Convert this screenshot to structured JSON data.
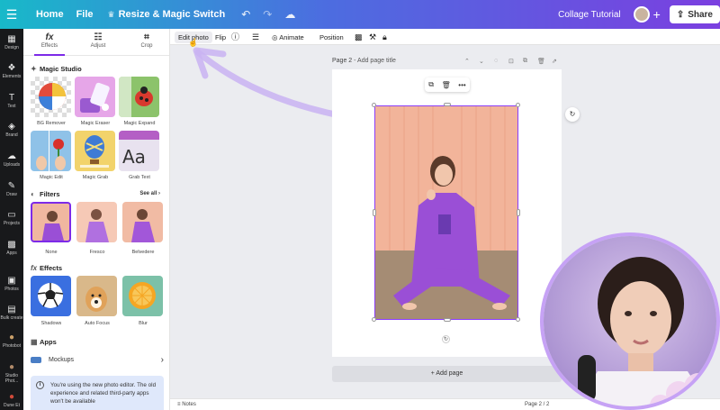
{
  "topbar": {
    "home": "Home",
    "file": "File",
    "resize": "Resize & Magic Switch",
    "title": "Collage Tutorial",
    "share": "Share"
  },
  "rail": [
    {
      "label": "Design",
      "icon": "▦"
    },
    {
      "label": "Elements",
      "icon": "❖"
    },
    {
      "label": "Text",
      "icon": "T"
    },
    {
      "label": "Brand",
      "icon": "◈"
    },
    {
      "label": "Uploads",
      "icon": "☁"
    },
    {
      "label": "Draw",
      "icon": "✎"
    },
    {
      "label": "Projects",
      "icon": "▭"
    },
    {
      "label": "Apps",
      "icon": "▩"
    },
    {
      "label": "Photos",
      "icon": "▣"
    },
    {
      "label": "Bulk create",
      "icon": "▤"
    },
    {
      "label": "Photobot",
      "icon": "●"
    },
    {
      "label": "Studio Phot...",
      "icon": "●"
    },
    {
      "label": "Dune Et",
      "icon": "●"
    }
  ],
  "panel": {
    "tabs": [
      {
        "label": "Effects",
        "icon": "fx"
      },
      {
        "label": "Adjust",
        "icon": "☷"
      },
      {
        "label": "Crop",
        "icon": "⌗"
      }
    ],
    "magic_studio": {
      "title": "Magic Studio",
      "items": [
        "BG Remover",
        "Magic Eraser",
        "Magic Expand",
        "Magic Edit",
        "Magic Grab",
        "Grab Text"
      ]
    },
    "filters": {
      "title": "Filters",
      "see_all": "See all",
      "items": [
        "None",
        "Fresco",
        "Belvedere"
      ]
    },
    "effects": {
      "title": "Effects",
      "items": [
        "Shadows",
        "Auto Focus",
        "Blur"
      ]
    },
    "apps": {
      "title": "Apps",
      "mockups": "Mockups"
    },
    "notice": "You're using the new photo editor. The old experience and related third-party apps won't be available"
  },
  "ctx": {
    "edit_photo": "Edit photo",
    "flip": "Flip",
    "animate": "Animate",
    "position": "Position"
  },
  "canvas": {
    "page_label": "Page 2",
    "page_title_placeholder": "Add page title",
    "add_page": "+ Add page"
  },
  "bottombar": {
    "notes": "Notes",
    "page_count": "Page 2 / 2"
  },
  "colors": {
    "accent": "#7d2ae8",
    "photo_bg": "#f2b49a",
    "outfit": "#9a4fd6"
  }
}
